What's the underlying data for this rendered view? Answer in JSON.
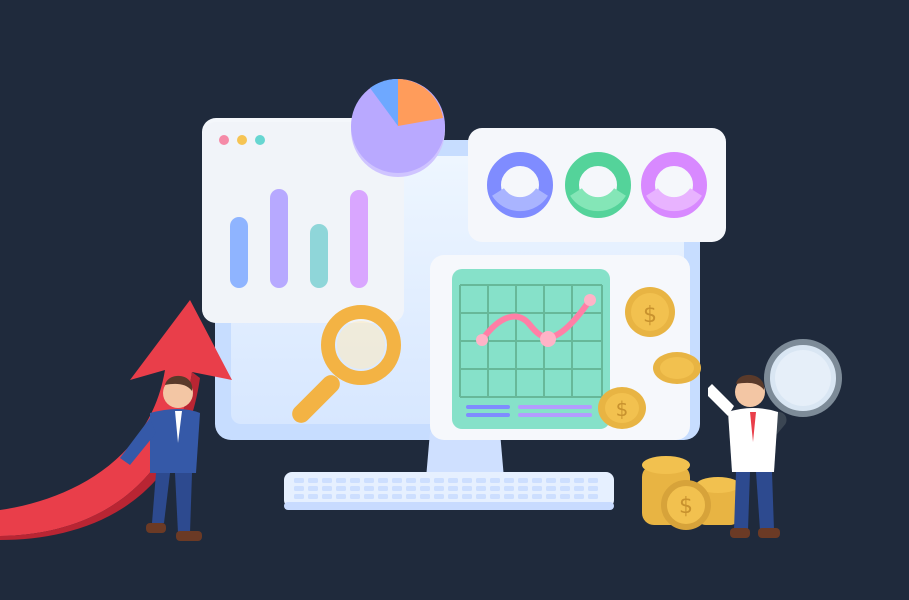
{
  "scene": {
    "background": "#1f2a3c",
    "window_dots": [
      "#f58aa7",
      "#f6c453",
      "#67d6d1"
    ],
    "bar_colors": [
      "#8fb4ff",
      "#b7a9ff",
      "#8fd6d9",
      "#d9a6ff"
    ],
    "bars_level": [
      0.62,
      0.86,
      0.56,
      0.85
    ],
    "pie_colors": [
      "#b9a9ff",
      "#ff9c5b",
      "#6ea8ff"
    ],
    "donut_colors": [
      "#7f8cff",
      "#54d39a",
      "#d889ff"
    ],
    "chart_grid_color": "#86e1c9",
    "chart_line_color": "#ff7fa6",
    "coin_color": "#f2c14f",
    "arrow_color": "#e93e4a",
    "magnifier_color": "#f3b344",
    "icons": [
      "pie-chart-icon",
      "bar-chart-icon",
      "donut-chart-icon",
      "line-chart-icon",
      "magnifier-icon",
      "dollar-coin-icon",
      "growth-arrow-icon",
      "businessman-icon",
      "keyboard-icon",
      "monitor-icon"
    ]
  }
}
